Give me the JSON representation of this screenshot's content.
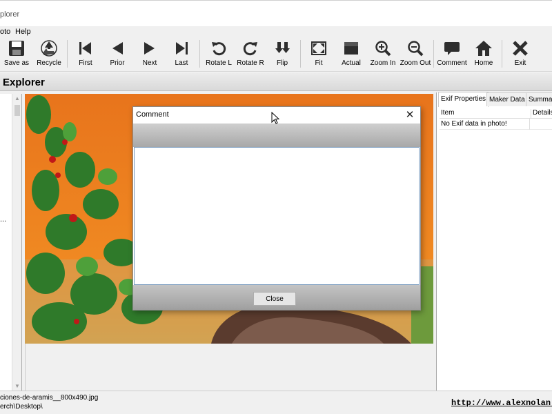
{
  "window": {
    "title": "plorer"
  },
  "menu": {
    "items": [
      "oto",
      "Help"
    ]
  },
  "toolbar": {
    "buttons": [
      {
        "label": "Save as",
        "icon": "save-icon"
      },
      {
        "label": "Recycle",
        "icon": "recycle-icon"
      },
      {
        "label": "First",
        "icon": "first-icon"
      },
      {
        "label": "Prior",
        "icon": "prior-icon"
      },
      {
        "label": "Next",
        "icon": "next-icon"
      },
      {
        "label": "Last",
        "icon": "last-icon"
      },
      {
        "label": "Rotate L",
        "icon": "rotate-left-icon"
      },
      {
        "label": "Rotate R",
        "icon": "rotate-right-icon"
      },
      {
        "label": "Flip",
        "icon": "flip-icon"
      },
      {
        "label": "Fit",
        "icon": "fit-icon"
      },
      {
        "label": "Actual",
        "icon": "actual-icon"
      },
      {
        "label": "Zoom In",
        "icon": "zoom-in-icon"
      },
      {
        "label": "Zoom Out",
        "icon": "zoom-out-icon"
      },
      {
        "label": "Comment",
        "icon": "comment-icon"
      },
      {
        "label": "Home",
        "icon": "home-icon"
      },
      {
        "label": "Exit",
        "icon": "exit-icon"
      }
    ]
  },
  "explorer": {
    "title": "Explorer",
    "left_text": "..."
  },
  "right_panel": {
    "tabs": [
      "Exif Properties",
      "Maker Data",
      "Summar"
    ],
    "columns": [
      "Item",
      "Details"
    ],
    "rows": [
      {
        "item": "No Exif data in photo!",
        "details": ""
      }
    ]
  },
  "dialog": {
    "title": "Comment",
    "close_glyph": "✕",
    "close_label": "Close",
    "text": ""
  },
  "status": {
    "filename": "ciones-de-aramis__800x490.jpg",
    "path": "erch\\Desktop\\",
    "link": "http://www.alexnolan.ne"
  },
  "colors": {
    "accent": "#e57f1a",
    "toolbar_icon": "#2e2e2e"
  }
}
